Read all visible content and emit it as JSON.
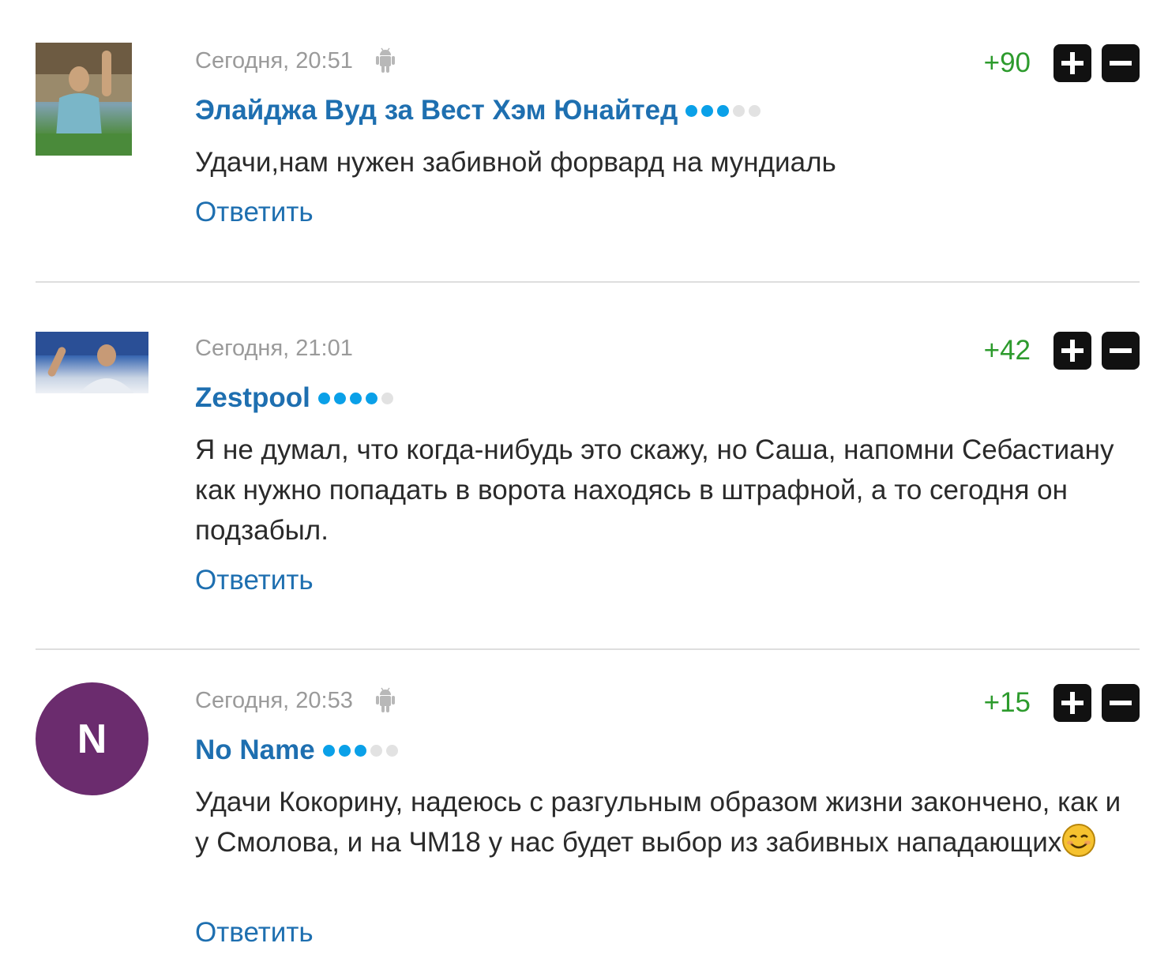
{
  "comments": [
    {
      "time": "Сегодня, 20:51",
      "platform_icon": "android-icon",
      "score": "+90",
      "author": "Элайджа Вуд за Вест Хэм Юнайтед",
      "rating_dots": 3,
      "text": "Удачи,нам нужен забивной форвард на мундиаль",
      "reply_label": "Ответить",
      "avatar": "photo"
    },
    {
      "time": "Сегодня, 21:01",
      "score": "+42",
      "author": "Zestpool",
      "rating_dots": 4,
      "text": "Я не думал, что когда-нибудь это скажу, но Саша, напомни Себастиану как нужно попадать в ворота находясь в штрафной, а то сегодня он подзабыл.",
      "reply_label": "Ответить",
      "avatar": "photo"
    },
    {
      "time": "Сегодня, 20:53",
      "platform_icon": "android-icon",
      "score": "+15",
      "author": "No Name",
      "rating_dots": 3,
      "text": "Удачи Кокорину, надеюсь с разгульным образом жизни закончено, как и у Смолова, и на ЧМ18 у нас будет выбор из забивных нападающих",
      "text_emoji": "smiling-face-emoji",
      "reply_label": "Ответить",
      "avatar": "initial",
      "avatar_initial": "N"
    }
  ],
  "colors": {
    "link": "#1e6fb0",
    "score": "#2d9b2d",
    "timestamp": "#9a9a9a",
    "rating_on": "#0aa0e8",
    "rating_off": "#e2e2e2",
    "avatar_initial_bg": "#6b2c6e"
  }
}
